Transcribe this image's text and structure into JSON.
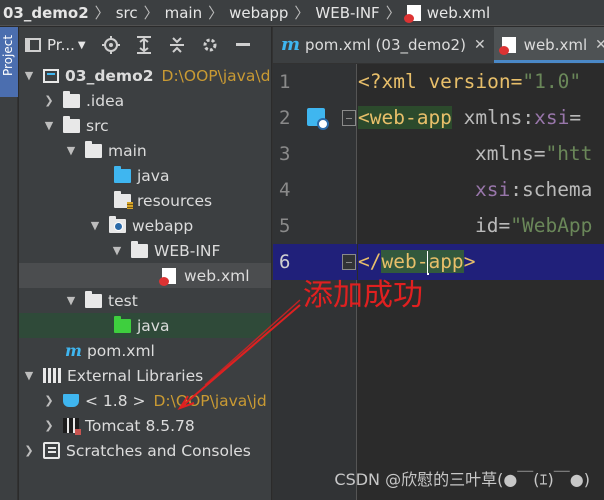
{
  "breadcrumb": [
    "03_demo2",
    "src",
    "main",
    "webapp",
    "WEB-INF",
    "web.xml"
  ],
  "stripe_label": "Project",
  "panel": {
    "title": "Pr..."
  },
  "tree": [
    {
      "label": "03_demo2",
      "path": "D:\\OOP\\java\\d"
    },
    {
      "label": ".idea"
    },
    {
      "label": "src"
    },
    {
      "label": "main"
    },
    {
      "label": "java"
    },
    {
      "label": "resources"
    },
    {
      "label": "webapp"
    },
    {
      "label": "WEB-INF"
    },
    {
      "label": "web.xml"
    },
    {
      "label": "test"
    },
    {
      "label": "java"
    },
    {
      "label": "pom.xml"
    },
    {
      "label": "External Libraries"
    },
    {
      "label": "< 1.8 >",
      "path": "D:\\OOP\\java\\jd"
    },
    {
      "label": "Tomcat 8.5.78"
    },
    {
      "label": "Scratches and Consoles"
    }
  ],
  "tabs": [
    {
      "label": "pom.xml (03_demo2)"
    },
    {
      "label": "web.xml"
    }
  ],
  "lines": [
    "1",
    "2",
    "3",
    "4",
    "5",
    "6"
  ],
  "code": {
    "l1_a": "<?xml version=",
    "l1_b": "\"1.0\"",
    "l2_tag": "<web-app",
    "l2_attr": " xmlns:",
    "l2_ns": "xsi",
    "l2_eq": "=",
    "l3_attr": "xmlns=",
    "l3_val": "\"htt",
    "l4_ns": "xsi",
    "l4_attr": ":schema",
    "l5_attr": "id=",
    "l5_val": "\"WebApp",
    "l6_open": "</",
    "l6_a": "web-",
    "l6_b": "app",
    "l6_close": ">"
  },
  "annotation": "添加成功",
  "watermark": "CSDN @欣慰的三叶草(●￣(ｴ)￣●)",
  "colors": {
    "annotation": "#e02020",
    "accent": "#4a88c7"
  }
}
